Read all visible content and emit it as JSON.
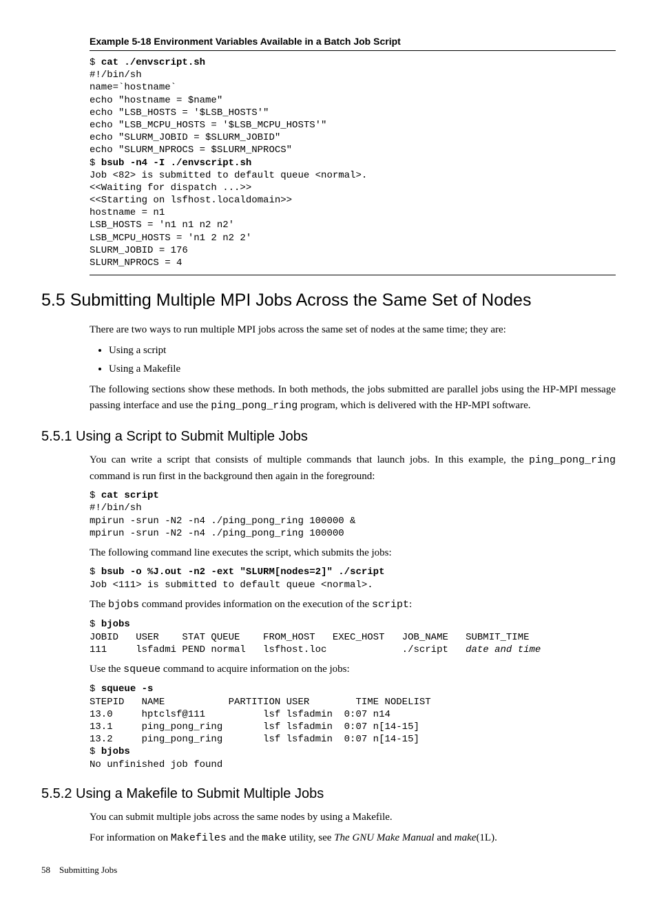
{
  "example_title": "Example 5-18  Environment Variables Available in a Batch Job Script",
  "code1": {
    "prompt1": "$ ",
    "cmd1": "cat ./envscript.sh",
    "l2": "#!/bin/sh",
    "l3": "name=`hostname`",
    "l4": "echo \"hostname = $name\"",
    "l5": "echo \"LSB_HOSTS = '$LSB_HOSTS'\"",
    "l6": "echo \"LSB_MCPU_HOSTS = '$LSB_MCPU_HOSTS'\"",
    "l7": "echo \"SLURM_JOBID = $SLURM_JOBID\"",
    "l8": "echo \"SLURM_NPROCS = $SLURM_NPROCS\"",
    "prompt2": "$ ",
    "cmd2": "bsub -n4 -I ./envscript.sh",
    "l10": "Job <82> is submitted to default queue <normal>.",
    "l11": "<<Waiting for dispatch ...>>",
    "l12": "<<Starting on lsfhost.localdomain>>",
    "l13": "hostname = n1",
    "l14": "LSB_HOSTS = 'n1 n1 n2 n2'",
    "l15": "LSB_MCPU_HOSTS = 'n1 2 n2 2'",
    "l16": "SLURM_JOBID = 176",
    "l17": "SLURM_NPROCS = 4"
  },
  "sec55_title": "5.5 Submitting Multiple MPI Jobs Across the Same Set of Nodes",
  "sec55_p1": "There are two ways to run multiple MPI jobs across the same set of nodes at the same time; they are:",
  "sec55_b1": "Using a script",
  "sec55_b2": "Using a Makefile",
  "sec55_p2a": "The following sections show these methods. In both methods, the jobs submitted are parallel jobs using the HP-MPI message passing interface and use the ",
  "sec55_p2_code": "ping_pong_ring",
  "sec55_p2b": " program, which is delivered with the HP-MPI software.",
  "sec551_title": "5.5.1 Using a Script to Submit Multiple Jobs",
  "sec551_p1a": "You can write a script that consists of multiple commands that launch jobs. In this example, the ",
  "sec551_p1_code": "ping_pong_ring",
  "sec551_p1b": " command is run first in the background then again in the foreground:",
  "code2": {
    "prompt": "$ ",
    "cmd": "cat script",
    "l2": "#!/bin/sh",
    "l3": "mpirun -srun -N2 -n4 ./ping_pong_ring 100000 &",
    "l4": "mpirun -srun -N2 -n4 ./ping_pong_ring 100000"
  },
  "sec551_p2": "The following command line executes the script, which submits the jobs:",
  "code3": {
    "prompt": "$ ",
    "cmd": "bsub -o %J.out -n2 -ext \"SLURM[nodes=2]\" ./script",
    "l2": "Job <111> is submitted to default queue <normal>."
  },
  "sec551_p3a": "The ",
  "sec551_p3_code1": "bjobs",
  "sec551_p3b": " command provides information on the execution of the ",
  "sec551_p3_code2": "script",
  "sec551_p3c": ":",
  "code4": {
    "prompt": "$ ",
    "cmd": "bjobs",
    "l2": "JOBID   USER    STAT QUEUE    FROM_HOST   EXEC_HOST   JOB_NAME   SUBMIT_TIME",
    "l3a": "111     lsfadmi PEND normal   lsfhost.loc             ./script   ",
    "l3b": "date and time"
  },
  "sec551_p4a": "Use the ",
  "sec551_p4_code": "squeue",
  "sec551_p4b": " command to acquire information on the jobs:",
  "code5": {
    "prompt1": "$ ",
    "cmd1": "squeue -s",
    "l2": "STEPID   NAME           PARTITION USER        TIME NODELIST",
    "l3": "13.0     hptclsf@111          lsf lsfadmin  0:07 n14",
    "l4": "13.1     ping_pong_ring       lsf lsfadmin  0:07 n[14-15]",
    "l5": "13.2     ping_pong_ring       lsf lsfadmin  0:07 n[14-15]",
    "prompt2": "$ ",
    "cmd2": "bjobs",
    "l7": "No unfinished job found"
  },
  "sec552_title": "5.5.2 Using a Makefile to Submit Multiple Jobs",
  "sec552_p1": "You can submit multiple jobs across the same nodes by using a Makefile.",
  "sec552_p2a": "For information on ",
  "sec552_p2_code1": "Makefiles",
  "sec552_p2b": " and the ",
  "sec552_p2_code2": "make",
  "sec552_p2c": " utility, see ",
  "sec552_p2_ital1": "The GNU Make Manual",
  "sec552_p2d": " and ",
  "sec552_p2_ital2": "make",
  "sec552_p2e": "(1L).",
  "footer_page": "58",
  "footer_text": "Submitting Jobs"
}
